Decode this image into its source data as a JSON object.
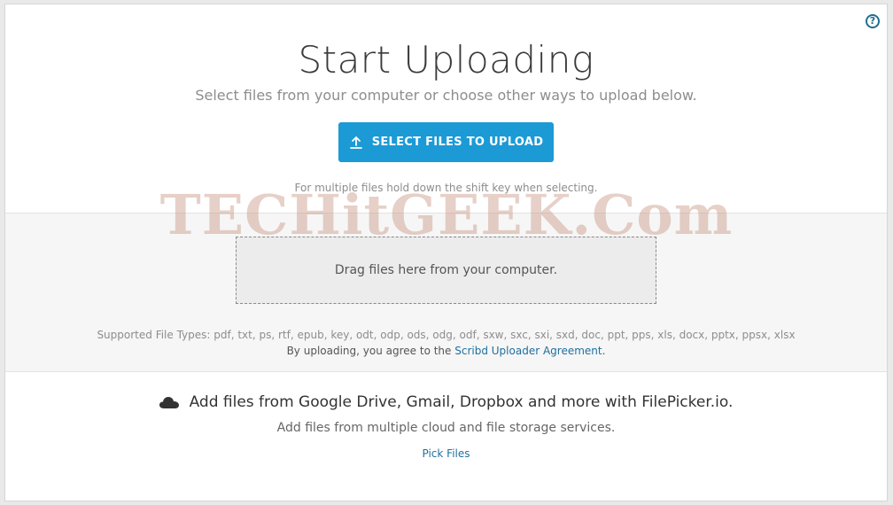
{
  "header": {
    "title": "Start Uploading",
    "subtitle": "Select files from your computer or choose other ways to upload below."
  },
  "help": {
    "icon": "help-icon",
    "glyph": "?"
  },
  "upload": {
    "button_label": "SELECT FILES TO UPLOAD",
    "button_icon": "upload-icon",
    "hint": "For multiple files hold down the shift key when selecting."
  },
  "dropzone": {
    "text": "Drag files here from your computer."
  },
  "supported": {
    "text": "Supported File Types: pdf, txt, ps, rtf, epub, key, odt, odp, ods, odg, odf, sxw, sxc, sxi, sxd, doc, ppt, pps, xls, docx, pptx, ppsx, xlsx"
  },
  "agreement": {
    "prefix": "By uploading, you agree to the ",
    "link": "Scribd Uploader Agreement",
    "suffix": "."
  },
  "filepicker": {
    "icon": "cloud-icon",
    "title": "Add files from Google Drive, Gmail, Dropbox and more with FilePicker.io.",
    "subtitle": "Add files from multiple cloud and file storage services.",
    "link": "Pick Files"
  },
  "watermark": {
    "text": "TECHitGEEK.Com"
  },
  "colors": {
    "accent": "#1b9ad6",
    "link": "#1e6f9e",
    "help": "#1e6f8e"
  }
}
